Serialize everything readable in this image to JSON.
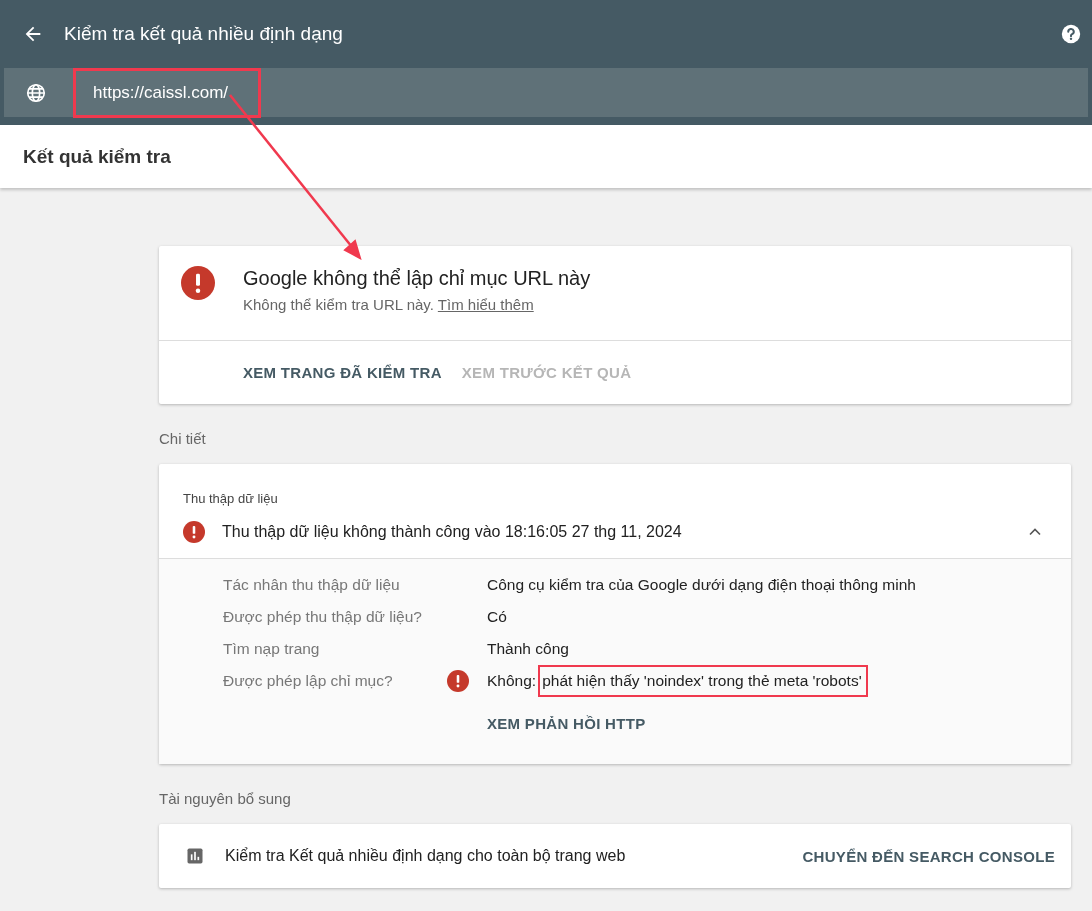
{
  "header": {
    "title": "Kiểm tra kết quả nhiều định dạng"
  },
  "url_bar": {
    "value": "https://caissl.com/",
    "highlighted": true
  },
  "annotation_arrow": true,
  "page_title": "Kết quả kiểm tra",
  "status_card": {
    "title": "Google không thể lập chỉ mục URL này",
    "message": "Không thể kiểm tra URL này.",
    "link": "Tìm hiểu thêm",
    "actions": [
      {
        "label": "XEM TRANG ĐÃ KIỂM TRA",
        "disabled": false
      },
      {
        "label": "XEM TRƯỚC KẾT QUẢ",
        "disabled": true
      }
    ]
  },
  "details_heading": "Chi tiết",
  "crawl_card": {
    "heading": "Thu thập dữ liệu",
    "summary": "Thu thập dữ liệu không thành công vào 18:16:05 27 thg 11, 2024",
    "expanded": true,
    "rows": [
      {
        "label": "Tác nhân thu thập dữ liệu",
        "value": "Công cụ kiểm tra của Google dưới dạng điện thoại thông minh",
        "error": false
      },
      {
        "label": "Được phép thu thập dữ liệu?",
        "value": "Có",
        "error": false
      },
      {
        "label": "Tìm nạp trang",
        "value": "Thành công",
        "error": false
      },
      {
        "label": "Được phép lập chỉ mục?",
        "value": "Không:",
        "highlighted_value": "phát hiện thấy 'noindex' trong thẻ meta 'robots'",
        "error": true
      }
    ],
    "action": "XEM PHẢN HỒI HTTP"
  },
  "resources_heading": "Tài nguyên bổ sung",
  "resource_card": {
    "text": "Kiểm tra Kết quả nhiều định dạng cho toàn bộ trang web",
    "action": "CHUYỂN ĐẾN SEARCH CONSOLE"
  }
}
